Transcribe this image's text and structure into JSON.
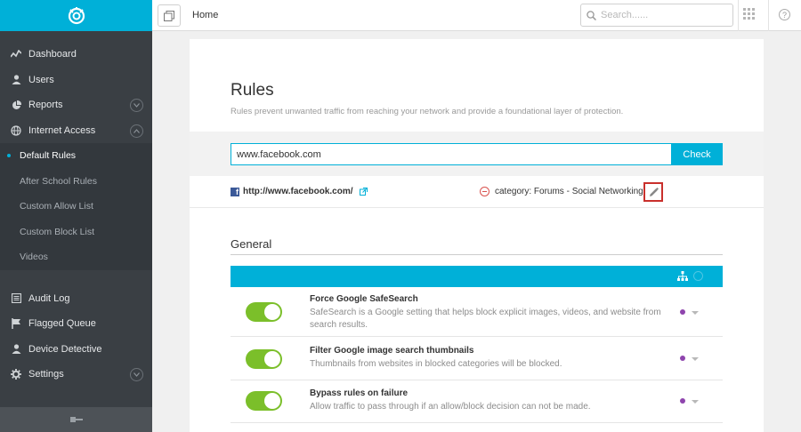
{
  "sidebar": {
    "items": [
      {
        "label": "Dashboard",
        "icon": "dashboard-icon"
      },
      {
        "label": "Users",
        "icon": "user-icon"
      },
      {
        "label": "Reports",
        "icon": "pie-chart-icon",
        "expandable": true
      },
      {
        "label": "Internet Access",
        "icon": "globe-icon",
        "expandable": true,
        "expanded": true
      }
    ],
    "subitems": [
      {
        "label": "Default Rules",
        "active": true
      },
      {
        "label": "After School Rules"
      },
      {
        "label": "Custom Allow List"
      },
      {
        "label": "Custom Block List"
      },
      {
        "label": "Videos"
      }
    ],
    "items2": [
      {
        "label": "Audit Log",
        "icon": "list-icon"
      },
      {
        "label": "Flagged Queue",
        "icon": "flag-icon"
      },
      {
        "label": "Device Detective",
        "icon": "user-search-icon"
      },
      {
        "label": "Settings",
        "icon": "gear-icon",
        "expandable": true
      }
    ]
  },
  "topbar": {
    "breadcrumb": "Home",
    "search_placeholder": "Search......"
  },
  "page": {
    "title": "Rules",
    "subtitle": "Rules prevent unwanted traffic from reaching your network and provide a foundational layer of protection."
  },
  "check": {
    "input_value": "www.facebook.com",
    "button_label": "Check"
  },
  "result": {
    "url": "http://www.facebook.com/",
    "category": "category: Forums - Social Networking"
  },
  "general": {
    "title": "General",
    "rules": [
      {
        "name": "Force Google SafeSearch",
        "desc": "SafeSearch is a Google setting that helps block explicit images, videos, and website from search results.",
        "enabled": true
      },
      {
        "name": "Filter Google image search thumbnails",
        "desc": "Thumbnails from websites in blocked categories will be blocked.",
        "enabled": true
      },
      {
        "name": "Bypass rules on failure",
        "desc": "Allow traffic to pass through if an allow/block decision can not be made.",
        "enabled": true
      }
    ]
  },
  "colors": {
    "accent": "#00b0d8",
    "sidebar": "#3a3f44",
    "toggle_on": "#7bbf2a",
    "status_dot": "#8e44ad",
    "highlight": "#c9302c"
  }
}
